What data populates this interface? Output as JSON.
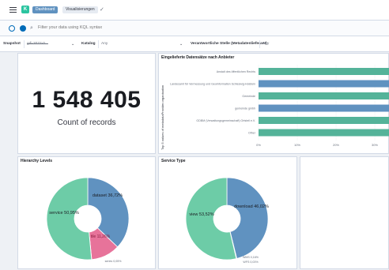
{
  "breadcrumbs": [
    "Dashboard",
    "Visualisierungen"
  ],
  "avatar_letter": "K",
  "search": {
    "placeholder": "Filter your data using KQL syntax"
  },
  "filters": [
    {
      "label": "Snapshot",
      "value": "gdi-2022-0..."
    },
    {
      "label": "Katalog",
      "value": "Any"
    },
    {
      "label": "Verantwortliche Stelle (Metadatenlieferant)",
      "value": "Any"
    }
  ],
  "metric": {
    "value": "1 548 405",
    "label": "Count of records"
  },
  "bar_panel": {
    "title": "Eingelieferte Datensätze nach Anbieter"
  },
  "hierarchy_panel": {
    "title": "Hierarchy Levels"
  },
  "service_panel": {
    "title": "Service Type"
  },
  "chart_data": [
    {
      "type": "bar",
      "orientation": "horizontal",
      "title": "Eingelieferte Datensätze nach Anbieter",
      "ylabel": "Top 5 values of metadataProvider.organisation",
      "categories": [
        "Anstalt des öffentlichen Rechts",
        "Landesamt für Vermessung und Geoinformation Schleswig-Holstein",
        "Gemeinde",
        "gemeinde gmbh",
        "GDBM (Verwaltungsgemeinschaft) Ortsteil e.V.",
        "Other"
      ],
      "values": [
        60,
        60,
        60,
        60,
        60,
        60
      ],
      "xticks": [
        "0%",
        "10%",
        "20%",
        "30%"
      ],
      "colors": [
        "#54b399",
        "#6092c0",
        "#54b399",
        "#6092c0",
        "#54b399",
        "#54b399"
      ]
    },
    {
      "type": "pie",
      "donut": true,
      "title": "Hierarchy Levels",
      "labels": [
        "dataset",
        "tile",
        "series",
        "service"
      ],
      "display": [
        "dataset 36,72%",
        "tile 11,26%",
        "series 0,05%",
        "service 50,95%"
      ],
      "values": [
        36.72,
        11.26,
        0.05,
        50.95
      ],
      "colors": [
        "#6092c0",
        "#e7739a",
        "#b9a888",
        "#6dcca7"
      ]
    },
    {
      "type": "pie",
      "donut": true,
      "title": "Service Type",
      "labels": [
        "download",
        "WMS",
        "WFS",
        "view"
      ],
      "display": [
        "download 46,02%",
        "WMS 0,16%",
        "WFS 0,03%",
        "view 53,52%"
      ],
      "values": [
        46.02,
        0.16,
        0.03,
        53.52
      ],
      "colors": [
        "#6092c0",
        "#d6bf57",
        "#b9a888",
        "#6dcca7"
      ]
    }
  ]
}
